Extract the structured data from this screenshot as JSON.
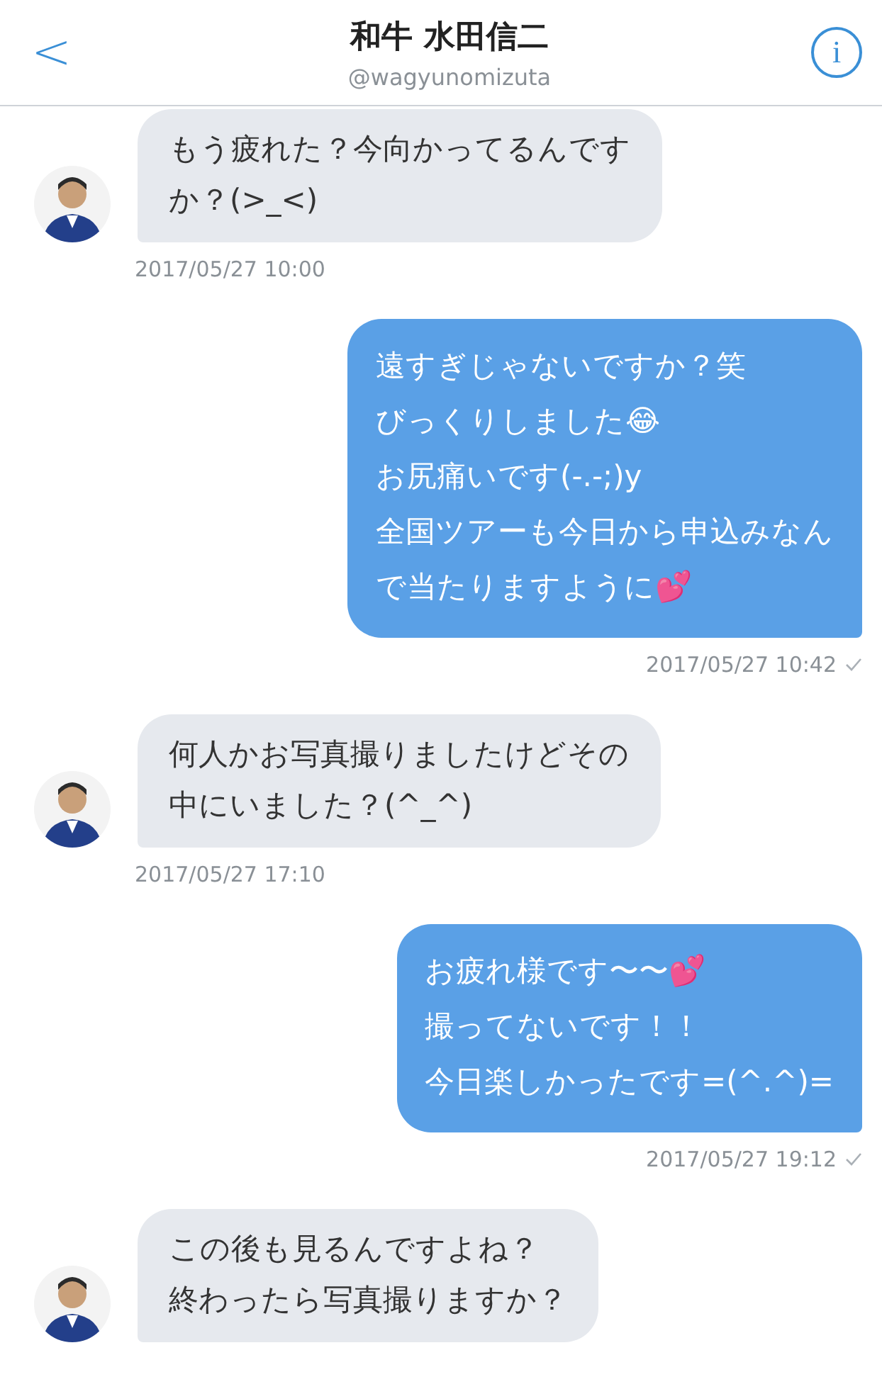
{
  "header": {
    "back": "<",
    "title": "和牛 水田信二",
    "handle": "@wagyunomizuta",
    "info": "i"
  },
  "messages": [
    {
      "kind": "received",
      "lines": [
        "もう疲れた？今向かってるんです",
        "か？(>_<)"
      ],
      "time": "2017/05/27 10:00",
      "delivered": false
    },
    {
      "kind": "sent",
      "lines": [
        "遠すぎじゃないですか？笑",
        "びっくりしました😂",
        "お尻痛いです(-.-;)y",
        "全国ツアーも今日から申込みなん",
        "で当たりますように💕"
      ],
      "time": "2017/05/27 10:42",
      "delivered": true
    },
    {
      "kind": "received",
      "lines": [
        "何人かお写真撮りましたけどその",
        "中にいました？(^_^)"
      ],
      "time": "2017/05/27 17:10",
      "delivered": false
    },
    {
      "kind": "sent",
      "lines": [
        "お疲れ様です〜〜💕",
        "撮ってないです！！",
        "今日楽しかったです=(^.^)="
      ],
      "time": "2017/05/27 19:12",
      "delivered": true
    },
    {
      "kind": "received",
      "lines": [
        "この後も見るんですよね？",
        "終わったら写真撮りますか？"
      ],
      "delivered": false
    }
  ]
}
